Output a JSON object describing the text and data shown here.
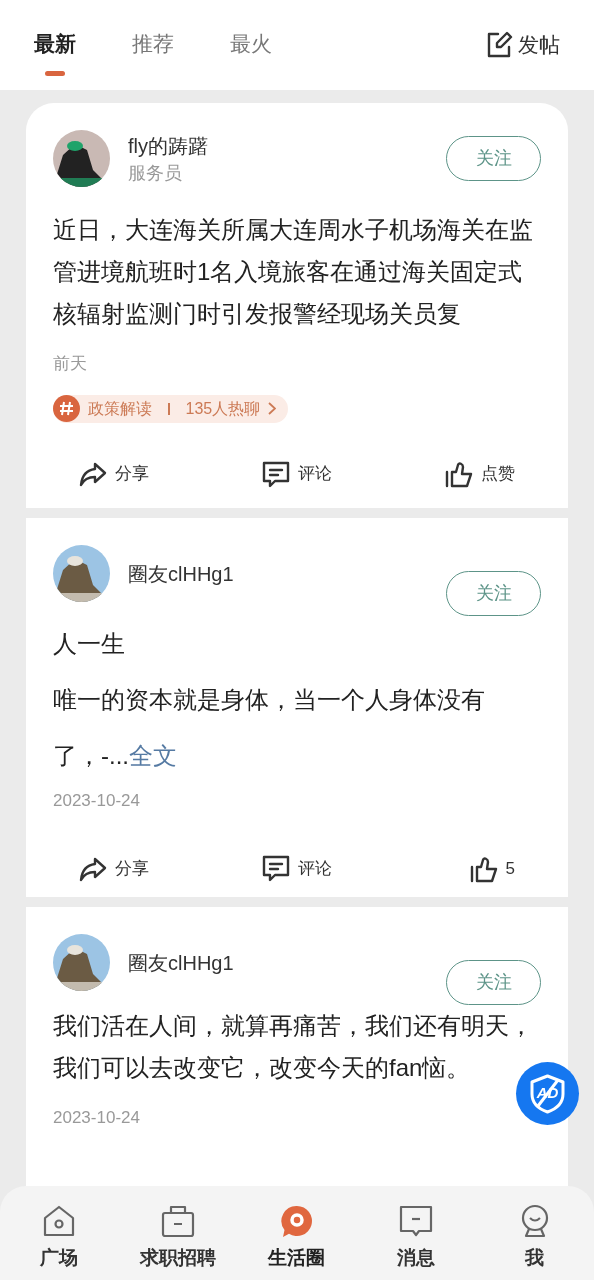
{
  "tabs": [
    {
      "label": "最新",
      "selected": true
    },
    {
      "label": "推荐",
      "selected": false
    },
    {
      "label": "最火",
      "selected": false
    }
  ],
  "post_button": {
    "label": "发帖"
  },
  "posts": [
    {
      "author": "fly的踌躇",
      "role": "服务员",
      "follow": "关注",
      "body": "近日，大连海关所属大连周水子机场海关在监管进境航班时1名入境旅客在通过海关固定式核辐射监测门时引发报警经现场关员复",
      "time": "前天",
      "topic": {
        "name": "政策解读",
        "heat": "135人热聊"
      },
      "actions": {
        "share": "分享",
        "comment": "评论",
        "like": "点赞"
      }
    },
    {
      "author": "圈友clHHg1",
      "follow": "关注",
      "title": "人一生",
      "body": "唯一的资本就是身体，当一个人身体没有了，-...",
      "more": "全文",
      "time": "2023-10-24",
      "actions": {
        "share": "分享",
        "comment": "评论",
        "like": "5"
      }
    },
    {
      "author": "圈友clHHg1",
      "follow": "关注",
      "body": "我们活在人间，就算再痛苦，我们还有明天，我们可以去改变它，改变今天的fan恼。",
      "time": "2023-10-24"
    }
  ],
  "ad_button": {
    "label": "AD"
  },
  "nav": [
    {
      "label": "广场",
      "selected": false
    },
    {
      "label": "求职招聘",
      "selected": false
    },
    {
      "label": "生活圈",
      "selected": true
    },
    {
      "label": "消息",
      "selected": false
    },
    {
      "label": "我",
      "selected": false
    }
  ]
}
